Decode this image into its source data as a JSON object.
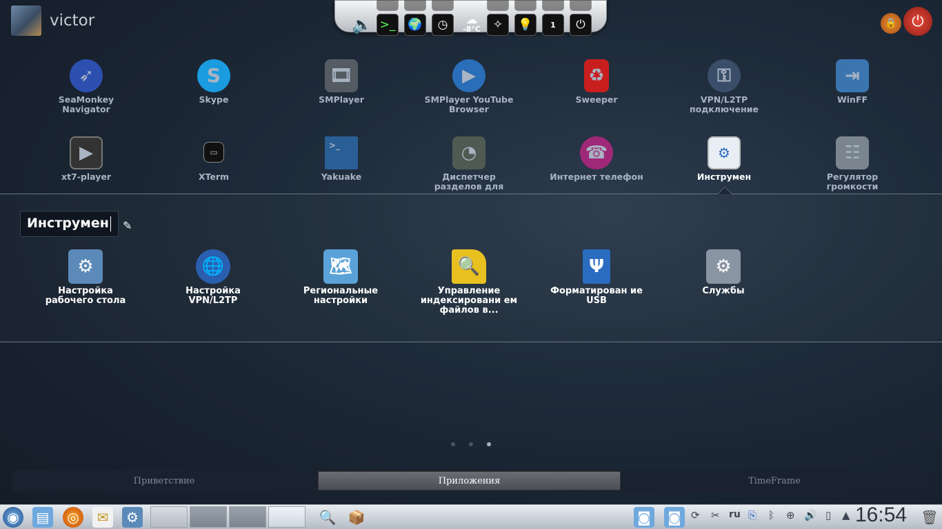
{
  "user": {
    "name": "victor"
  },
  "widgets": {
    "temperature": "-8°C",
    "counter": "1"
  },
  "apps_row1": [
    {
      "label": "SeaMonkey Navigator",
      "icon": "seamonkey-icon",
      "color": "#2c4fb0"
    },
    {
      "label": "Skype",
      "icon": "skype-icon",
      "color": "#1b9be0"
    },
    {
      "label": "SMPlayer",
      "icon": "smplayer-icon",
      "color": "#555b62"
    },
    {
      "label": "SMPlayer YouTube Browser",
      "icon": "smplayer-youtube-icon",
      "color": "#2a6db8"
    },
    {
      "label": "Sweeper",
      "icon": "sweeper-icon",
      "color": "#c81e1e"
    },
    {
      "label": "VPN/L2TP подключение",
      "icon": "vpn-icon",
      "color": "#3a4e6a"
    },
    {
      "label": "WinFF",
      "icon": "winff-icon",
      "color": "#3a75b0"
    }
  ],
  "apps_row2": [
    {
      "label": "xt7-player",
      "icon": "xt7-player-icon",
      "color": "#333"
    },
    {
      "label": "XTerm",
      "icon": "xterm-icon",
      "color": "#111"
    },
    {
      "label": "Yakuake",
      "icon": "yakuake-icon",
      "color": "#2a5f96"
    },
    {
      "label": "Диспетчер разделов для",
      "icon": "partition-manager-icon",
      "color": "#4f5b52"
    },
    {
      "label": "Интернет телефон",
      "icon": "internet-phone-icon",
      "color": "#a02878"
    },
    {
      "label": "Инструмен",
      "icon": "tools-folder-icon",
      "color": "#e9eef4"
    },
    {
      "label": "Регулятор громкости",
      "icon": "volume-control-icon",
      "color": "#7b8590"
    }
  ],
  "folder": {
    "name": "Инструмен",
    "items": [
      {
        "label": "Настройка рабочего стола",
        "icon": "desktop-settings-icon",
        "color": "#5c8ab8"
      },
      {
        "label": "Настройка VPN/L2TP",
        "icon": "vpn-settings-icon",
        "color": "#2a5fb0"
      },
      {
        "label": "Региональные настройки",
        "icon": "regional-settings-icon",
        "color": "#5aa2d8"
      },
      {
        "label": "Управление индексировани ем файлов в...",
        "icon": "file-indexing-icon",
        "color": "#e8c020"
      },
      {
        "label": "Форматирован ие USB",
        "icon": "usb-format-icon",
        "color": "#2a6cc0"
      },
      {
        "label": "Службы",
        "icon": "services-icon",
        "color": "#8a95a3"
      }
    ]
  },
  "pages": {
    "count": 3,
    "active": 2
  },
  "tabs": [
    {
      "label": "Приветствие"
    },
    {
      "label": "Приложения"
    },
    {
      "label": "TimeFrame"
    }
  ],
  "tray": {
    "lang": "ru",
    "clock": "16:54"
  }
}
